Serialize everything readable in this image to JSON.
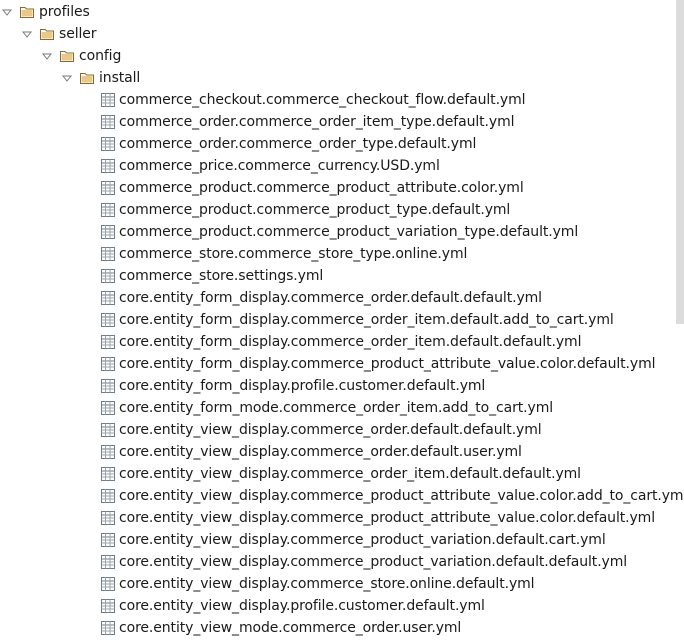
{
  "tree": {
    "folders": [
      {
        "label": "profiles",
        "icon": "folder-icon",
        "expanded": true
      },
      {
        "label": "seller",
        "icon": "folder-icon",
        "expanded": true
      },
      {
        "label": "config",
        "icon": "folder-icon",
        "expanded": true
      },
      {
        "label": "install",
        "icon": "folder-icon",
        "expanded": true
      }
    ],
    "files": [
      "commerce_checkout.commerce_checkout_flow.default.yml",
      "commerce_order.commerce_order_item_type.default.yml",
      "commerce_order.commerce_order_type.default.yml",
      "commerce_price.commerce_currency.USD.yml",
      "commerce_product.commerce_product_attribute.color.yml",
      "commerce_product.commerce_product_type.default.yml",
      "commerce_product.commerce_product_variation_type.default.yml",
      "commerce_store.commerce_store_type.online.yml",
      "commerce_store.settings.yml",
      "core.entity_form_display.commerce_order.default.default.yml",
      "core.entity_form_display.commerce_order_item.default.add_to_cart.yml",
      "core.entity_form_display.commerce_order_item.default.default.yml",
      "core.entity_form_display.commerce_product_attribute_value.color.default.yml",
      "core.entity_form_display.profile.customer.default.yml",
      "core.entity_form_mode.commerce_order_item.add_to_cart.yml",
      "core.entity_view_display.commerce_order.default.default.yml",
      "core.entity_view_display.commerce_order.default.user.yml",
      "core.entity_view_display.commerce_order_item.default.default.yml",
      "core.entity_view_display.commerce_product_attribute_value.color.add_to_cart.yml",
      "core.entity_view_display.commerce_product_attribute_value.color.default.yml",
      "core.entity_view_display.commerce_product_variation.default.cart.yml",
      "core.entity_view_display.commerce_product_variation.default.default.yml",
      "core.entity_view_display.commerce_store.online.default.yml",
      "core.entity_view_display.profile.customer.default.yml",
      "core.entity_view_mode.commerce_order.user.yml"
    ]
  },
  "colors": {
    "folder_fill": "#e9c98a",
    "folder_stroke": "#8a6a2a",
    "arrow": "#777777",
    "file_stroke": "#6f7b86"
  }
}
